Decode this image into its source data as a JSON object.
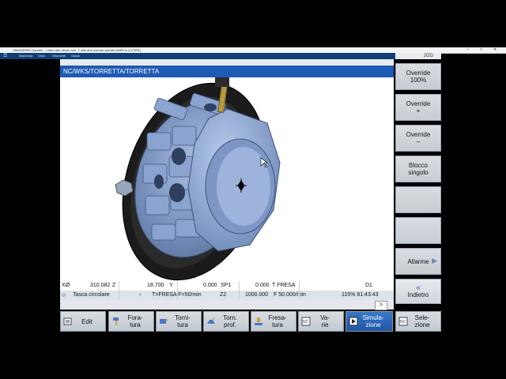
{
  "window": {
    "title": "SINUMERIK Operate – Lathe with driven tool, Y axis and counter spindle (840D sl 4.8 SP4)"
  },
  "menubar": {
    "items": [
      "Macchina",
      "Vista",
      "Strumenti",
      "Guida"
    ]
  },
  "header": {
    "faint_text": "",
    "path": "NC/WKS/TORRETTA/TORRETTA"
  },
  "status": {
    "x_label": "XØ",
    "x_value": "310.082",
    "z_axis": "Z",
    "z_value": "18.700",
    "y_axis": "Y",
    "sp_value": "0.000",
    "sp_label": "SP1",
    "t_value": "0.000",
    "t_label": "T FRESA",
    "d_label": "D1",
    "cycle": "Tasca circolare",
    "tool": "T=FRESA F=50/min",
    "z2": "Z2",
    "feed_value": "1000.000",
    "feed_text": "F 50.000/min",
    "time": "115% 81:43:43"
  },
  "cmd": {
    "arrow": ">"
  },
  "vertical_softkeys": [
    {
      "label": "Override\n100%"
    },
    {
      "label": "Override\n+"
    },
    {
      "label": "Override\n–"
    },
    {
      "label": "Blocco\nsingolo"
    },
    {
      "label": ""
    },
    {
      "label": ""
    },
    {
      "label": "Allarme"
    },
    {
      "label": "Indietro"
    }
  ],
  "vertical_top_label": "JOG",
  "horizontal_softkeys": [
    {
      "label": "Edit",
      "icon": "edit-icon"
    },
    {
      "label": "Fora-\ntura",
      "icon": "drill-icon"
    },
    {
      "label": "Torni-\ntura",
      "icon": "turning-icon"
    },
    {
      "label": "Torn.\nprof.",
      "icon": "contour-turning-icon"
    },
    {
      "label": "Fresa-\ntura",
      "icon": "milling-icon"
    },
    {
      "label": "Va-\nrie",
      "icon": "misc-icon"
    },
    {
      "label": "Simula-\nzione",
      "icon": "simulation-icon"
    },
    {
      "label": "Sele-\nzione",
      "icon": "selection-icon"
    }
  ],
  "colors": {
    "accent": "#1e5bb5",
    "model_blue": "#7f9bc9",
    "disc": "#1b1b1b",
    "softkey": "#cdd2d8"
  }
}
